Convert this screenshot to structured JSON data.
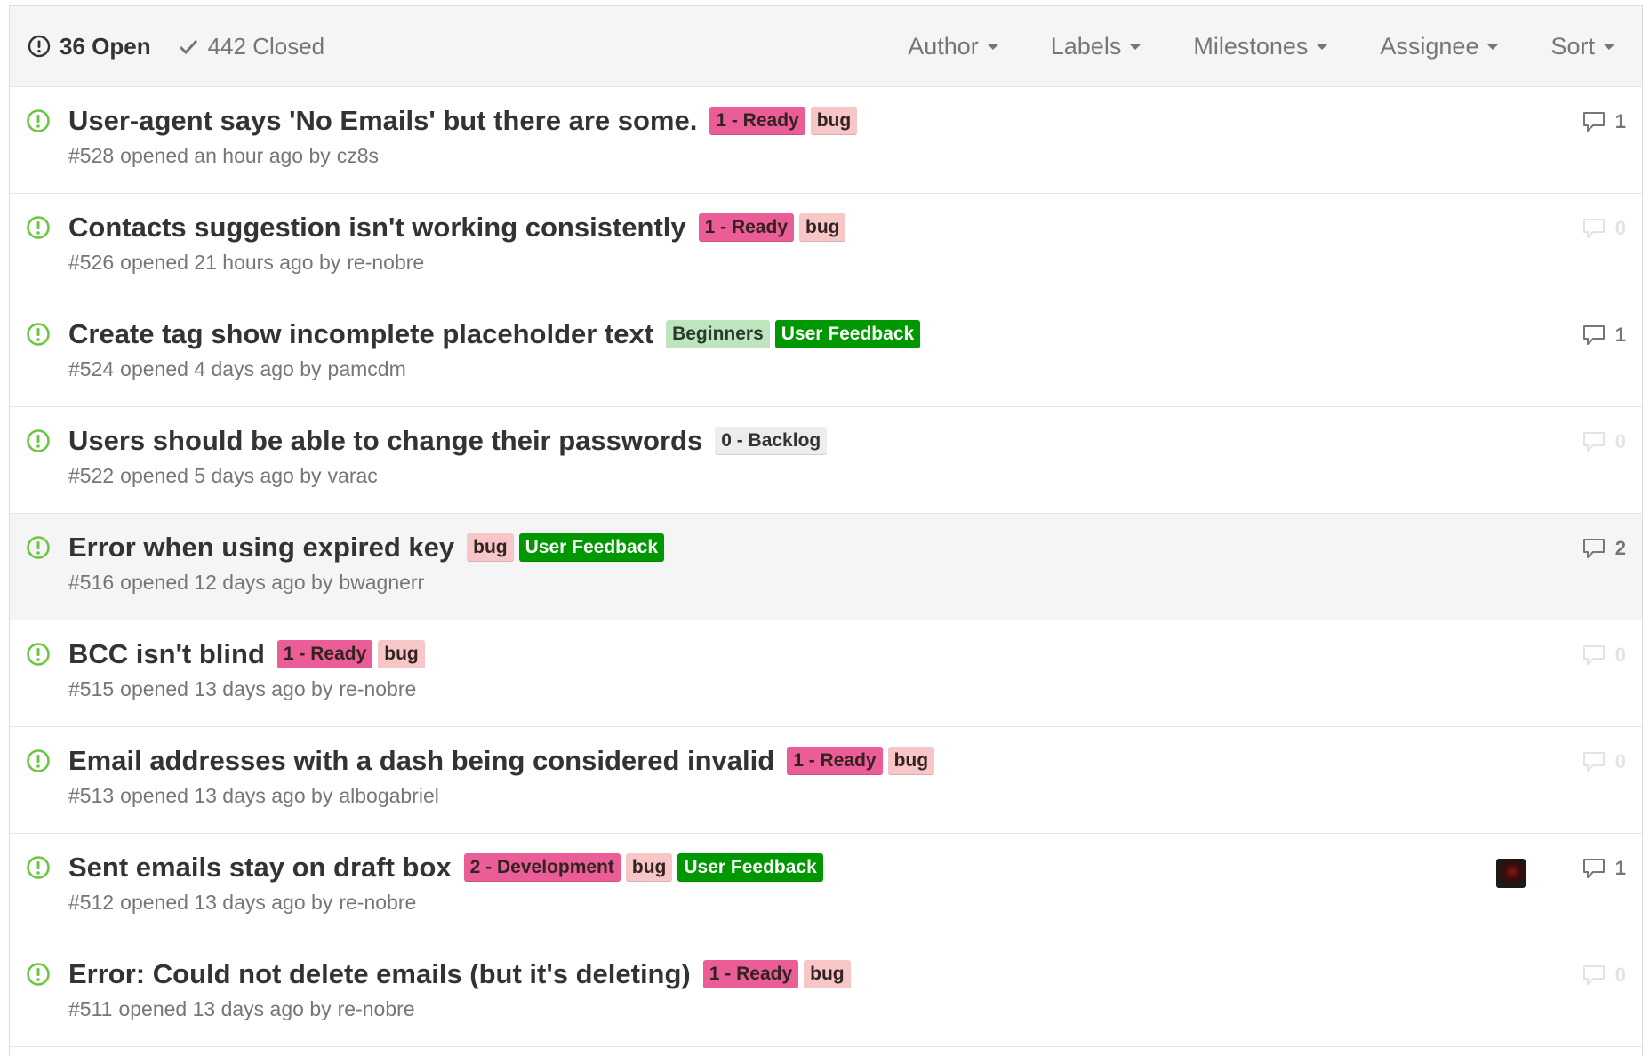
{
  "header": {
    "open_count": "36 Open",
    "closed_count": "442 Closed",
    "filters": [
      {
        "label": "Author"
      },
      {
        "label": "Labels"
      },
      {
        "label": "Milestones"
      },
      {
        "label": "Assignee"
      },
      {
        "label": "Sort"
      }
    ]
  },
  "colors": {
    "open_icon": "#6cc644",
    "ready_bg": "#ea5d97",
    "bug_bg": "#f7c6c7",
    "beginners_bg": "#bfe5bf",
    "user_feedback_bg": "#009800",
    "backlog_bg": "#ededed"
  },
  "issues": [
    {
      "title": "User-agent says 'No Emails' but there are some.",
      "number": "#528",
      "opened": "opened an hour ago by",
      "author": "cz8s",
      "labels": [
        {
          "text": "1 - Ready",
          "bg": "#ea5d97",
          "fg": "#332222"
        },
        {
          "text": "bug",
          "bg": "#f7c6c7",
          "fg": "#332222"
        }
      ],
      "comments": "1",
      "has_comments": true,
      "avatar": false
    },
    {
      "title": "Contacts suggestion isn't working consistently",
      "number": "#526",
      "opened": "opened 21 hours ago by",
      "author": "re-nobre",
      "labels": [
        {
          "text": "1 - Ready",
          "bg": "#ea5d97",
          "fg": "#332222"
        },
        {
          "text": "bug",
          "bg": "#f7c6c7",
          "fg": "#332222"
        }
      ],
      "comments": "0",
      "has_comments": false,
      "avatar": false
    },
    {
      "title": "Create tag show incomplete placeholder text",
      "number": "#524",
      "opened": "opened 4 days ago by",
      "author": "pamcdm",
      "labels": [
        {
          "text": "Beginners",
          "bg": "#bfe5bf",
          "fg": "#2a3a2a"
        },
        {
          "text": "User Feedback",
          "bg": "#009800",
          "fg": "#ffffff"
        }
      ],
      "comments": "1",
      "has_comments": true,
      "avatar": false
    },
    {
      "title": "Users should be able to change their passwords",
      "number": "#522",
      "opened": "opened 5 days ago by",
      "author": "varac",
      "labels": [
        {
          "text": "0 - Backlog",
          "bg": "#ededed",
          "fg": "#333333"
        }
      ],
      "comments": "0",
      "has_comments": false,
      "avatar": false
    },
    {
      "title": "Error when using expired key",
      "number": "#516",
      "opened": "opened 12 days ago by",
      "author": "bwagnerr",
      "labels": [
        {
          "text": "bug",
          "bg": "#f7c6c7",
          "fg": "#332222"
        },
        {
          "text": "User Feedback",
          "bg": "#009800",
          "fg": "#ffffff"
        }
      ],
      "comments": "2",
      "has_comments": true,
      "avatar": false,
      "hover": true
    },
    {
      "title": "BCC isn't blind",
      "number": "#515",
      "opened": "opened 13 days ago by",
      "author": "re-nobre",
      "labels": [
        {
          "text": "1 - Ready",
          "bg": "#ea5d97",
          "fg": "#332222"
        },
        {
          "text": "bug",
          "bg": "#f7c6c7",
          "fg": "#332222"
        }
      ],
      "comments": "0",
      "has_comments": false,
      "avatar": false
    },
    {
      "title": "Email addresses with a dash being considered invalid",
      "number": "#513",
      "opened": "opened 13 days ago by",
      "author": "albogabriel",
      "labels": [
        {
          "text": "1 - Ready",
          "bg": "#ea5d97",
          "fg": "#332222"
        },
        {
          "text": "bug",
          "bg": "#f7c6c7",
          "fg": "#332222"
        }
      ],
      "comments": "0",
      "has_comments": false,
      "avatar": false
    },
    {
      "title": "Sent emails stay on draft box",
      "number": "#512",
      "opened": "opened 13 days ago by",
      "author": "re-nobre",
      "labels": [
        {
          "text": "2 - Development",
          "bg": "#ea5d97",
          "fg": "#332222"
        },
        {
          "text": "bug",
          "bg": "#f7c6c7",
          "fg": "#332222"
        },
        {
          "text": "User Feedback",
          "bg": "#009800",
          "fg": "#ffffff"
        }
      ],
      "comments": "1",
      "has_comments": true,
      "avatar": true
    },
    {
      "title": "Error: Could not delete emails (but it's deleting)",
      "number": "#511",
      "opened": "opened 13 days ago by",
      "author": "re-nobre",
      "labels": [
        {
          "text": "1 - Ready",
          "bg": "#ea5d97",
          "fg": "#332222"
        },
        {
          "text": "bug",
          "bg": "#f7c6c7",
          "fg": "#332222"
        }
      ],
      "comments": "0",
      "has_comments": false,
      "avatar": false
    }
  ]
}
